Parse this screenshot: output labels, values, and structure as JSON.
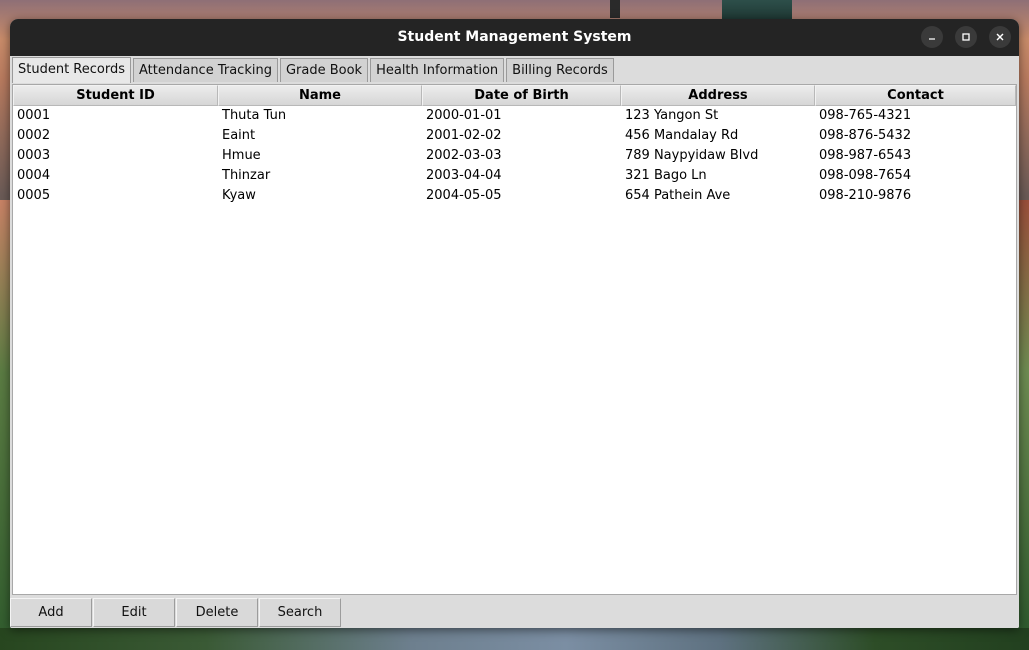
{
  "window": {
    "title": "Student Management System"
  },
  "tabs": [
    {
      "label": "Student Records",
      "active": true
    },
    {
      "label": "Attendance Tracking",
      "active": false
    },
    {
      "label": "Grade Book",
      "active": false
    },
    {
      "label": "Health Information",
      "active": false
    },
    {
      "label": "Billing Records",
      "active": false
    }
  ],
  "table": {
    "columns": [
      "Student ID",
      "Name",
      "Date of Birth",
      "Address",
      "Contact"
    ],
    "rows": [
      [
        "0001",
        "Thuta Tun",
        "2000-01-01",
        "123 Yangon St",
        "098-765-4321"
      ],
      [
        "0002",
        "Eaint",
        "2001-02-02",
        "456 Mandalay Rd",
        "098-876-5432"
      ],
      [
        "0003",
        "Hmue",
        "2002-03-03",
        "789 Naypyidaw Blvd",
        "098-987-6543"
      ],
      [
        "0004",
        "Thinzar",
        "2003-04-04",
        "321 Bago Ln",
        "098-098-7654"
      ],
      [
        "0005",
        "Kyaw",
        "2004-05-05",
        "654 Pathein Ave",
        "098-210-9876"
      ]
    ]
  },
  "buttons": {
    "add": "Add",
    "edit": "Edit",
    "delete": "Delete",
    "search": "Search"
  },
  "icons": {
    "minimize": "minimize-icon",
    "maximize": "maximize-icon",
    "close": "close-icon"
  },
  "colors": {
    "titlebar": "#242424",
    "window_bg": "#dcdcdc",
    "table_bg": "#ffffff"
  }
}
